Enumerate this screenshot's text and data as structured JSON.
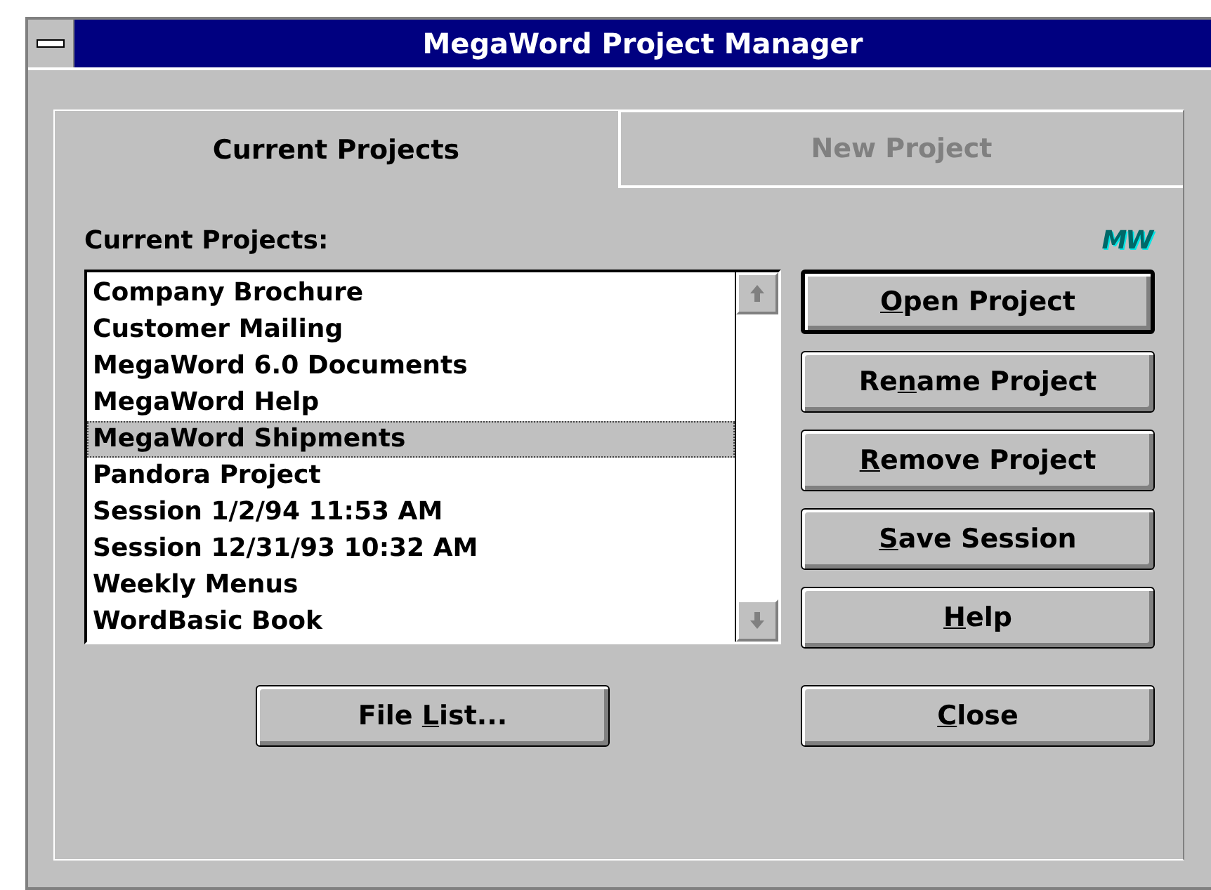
{
  "window": {
    "title": "MegaWord Project Manager"
  },
  "tabs": [
    {
      "label": "Current Projects",
      "selected": true
    },
    {
      "label": "New Project",
      "selected": false
    }
  ],
  "list_label": "Current Projects:",
  "logo": "MW",
  "projects": [
    {
      "name": "Company Brochure",
      "selected": false
    },
    {
      "name": "Customer Mailing",
      "selected": false
    },
    {
      "name": "MegaWord 6.0 Documents",
      "selected": false
    },
    {
      "name": "MegaWord Help",
      "selected": false
    },
    {
      "name": "MegaWord Shipments",
      "selected": true
    },
    {
      "name": "Pandora Project",
      "selected": false
    },
    {
      "name": "Session 1/2/94 11:53 AM",
      "selected": false
    },
    {
      "name": "Session 12/31/93 10:32 AM",
      "selected": false
    },
    {
      "name": "Weekly Menus",
      "selected": false
    },
    {
      "name": "WordBasic Book",
      "selected": false
    }
  ],
  "buttons": [
    {
      "key": "O",
      "post": "pen Project",
      "default": true
    },
    {
      "pre": "Re",
      "key": "n",
      "post": "ame Project",
      "default": false
    },
    {
      "key": "R",
      "post": "emove Project",
      "default": false
    },
    {
      "key": "S",
      "post": "ave Session",
      "default": false
    },
    {
      "key": "H",
      "post": "elp",
      "default": false
    }
  ],
  "file_list_button": {
    "pre": "File ",
    "key": "L",
    "post": "ist...",
    "default": false
  },
  "close_button": {
    "key": "C",
    "post": "lose",
    "default": false
  }
}
